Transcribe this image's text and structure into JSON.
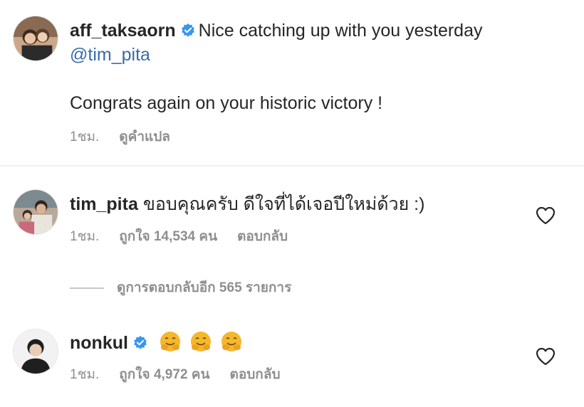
{
  "comments": [
    {
      "username": "aff_taksaorn",
      "verified": true,
      "text_line1": "Nice catching up with you yesterday",
      "mention": "@tim_pita",
      "text_line3": "Congrats again on your historic victory !",
      "time": "1ชม.",
      "translate": "ดูคำแปล"
    },
    {
      "username": "tim_pita",
      "verified": false,
      "text": "ขอบคุณครับ ดีใจที่ได้เจอปีใหม่ด้วย :)",
      "time": "1ชม.",
      "likes": "ถูกใจ 14,534 คน",
      "reply": "ตอบกลับ",
      "view_replies": "ดูการตอบกลับอีก 565 รายการ"
    },
    {
      "username": "nonkul",
      "verified": true,
      "emojis": [
        "hugging-face-emoji",
        "hugging-face-emoji",
        "hugging-face-emoji"
      ],
      "time": "1ชม.",
      "likes": "ถูกใจ 4,972 คน",
      "reply": "ตอบกลับ"
    }
  ],
  "colors": {
    "text": "#262626",
    "secondary": "#8e8e8e",
    "mention": "#3a6ba8",
    "verified": "#3797f0",
    "emoji": "#f5b72c"
  }
}
